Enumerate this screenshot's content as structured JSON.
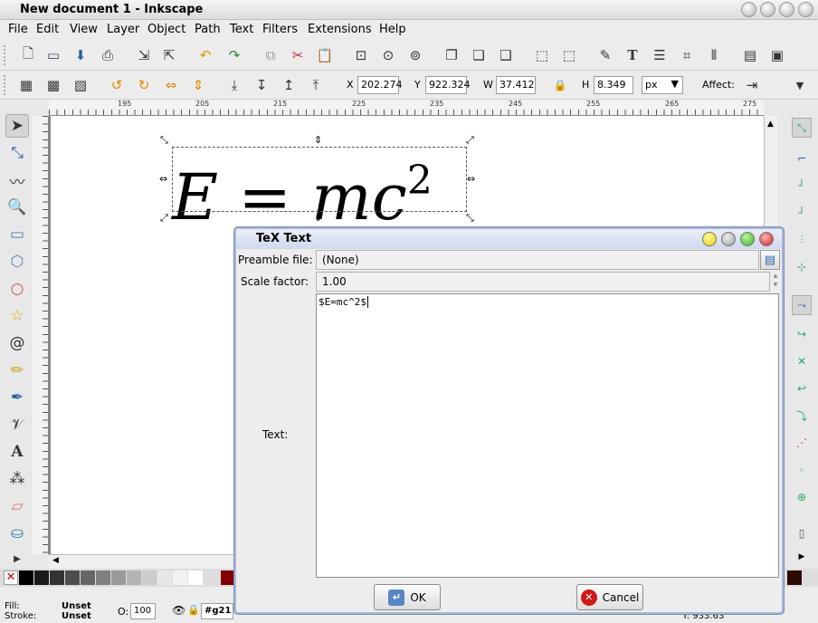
{
  "window": {
    "title": "New document 1 - Inkscape"
  },
  "menu": [
    "File",
    "Edit",
    "View",
    "Layer",
    "Object",
    "Path",
    "Text",
    "Filters",
    "Extensions",
    "Help"
  ],
  "controls": {
    "x_label": "X",
    "x_value": "202.274",
    "y_label": "Y",
    "y_value": "922.324",
    "w_label": "W",
    "w_value": "37.412",
    "h_label": "H",
    "h_value": "8.349",
    "unit": "px",
    "affect_label": "Affect:"
  },
  "ruler": {
    "h_ticks": [
      "195",
      "205",
      "215",
      "225",
      "235",
      "245",
      "255",
      "265",
      "275"
    ]
  },
  "canvas": {
    "formula_text": "E = mc",
    "formula_exp": "2"
  },
  "dialog": {
    "title": "TeX Text",
    "preamble_label": "Preamble file:",
    "preamble_value": "(None)",
    "scale_label": "Scale factor:",
    "scale_value": "1.00",
    "text_label": "Text:",
    "text_value": "$E=mc^2$",
    "ok_label": "OK",
    "cancel_label": "Cancel"
  },
  "status": {
    "fill_label": "Fill:",
    "fill_value": "Unset",
    "stroke_label": "Stroke:",
    "stroke_value": "Unset",
    "opacity_label": "O:",
    "opacity_value": "100",
    "layer_value": "#g21",
    "y_coord": "Y: 933.63"
  },
  "colors": {
    "accent": "#a9b7d8",
    "palette": [
      "#000000",
      "#1a1a1a",
      "#333333",
      "#4d4d4d",
      "#666666",
      "#808080",
      "#999999",
      "#b3b3b3",
      "#cccccc",
      "#e6e6e6",
      "#ffffff",
      "#800000"
    ]
  }
}
